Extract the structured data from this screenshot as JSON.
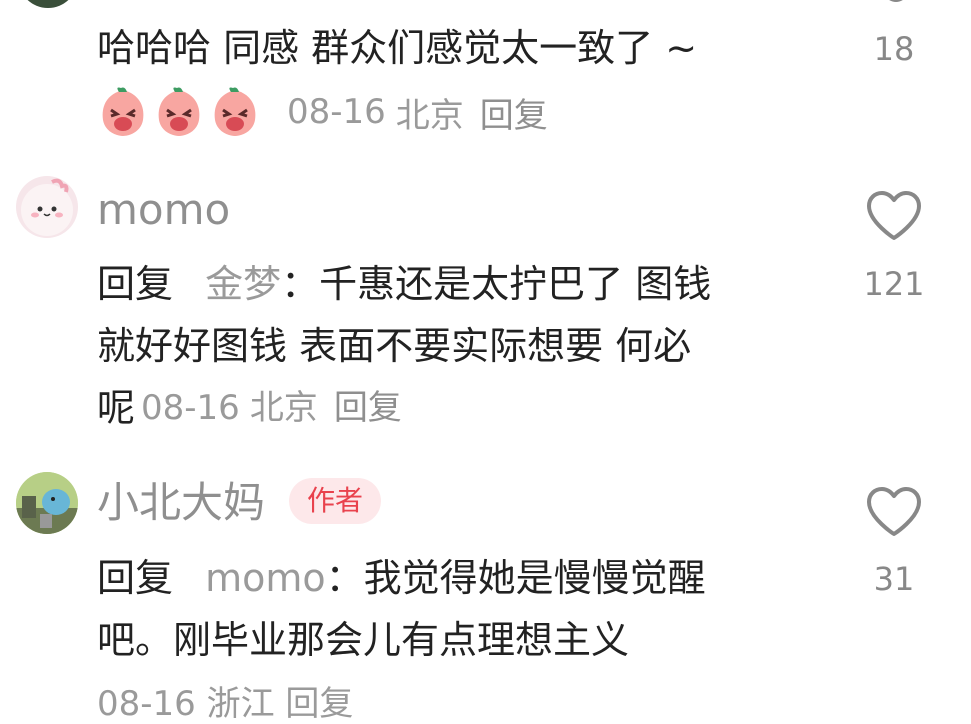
{
  "comment1": {
    "text": "哈哈哈 同感 群众们感觉太一致了 ~",
    "date": "08-16",
    "location": "北京",
    "reply": "回复",
    "likes": "18"
  },
  "comment2": {
    "username": "momo",
    "reply_prefix": "回复",
    "mention": "金梦",
    "line1": "：千惠还是太拧巴了 图钱",
    "line2": "就好好图钱 表面不要实际想要 何必",
    "line3": "呢",
    "date": "08-16",
    "location": "北京",
    "reply": "回复",
    "likes": "121"
  },
  "comment3": {
    "username": "小北大妈",
    "badge": "作者",
    "reply_prefix": "回复",
    "mention": "momo",
    "line1": "：我觉得她是慢慢觉醒",
    "line2": "吧。刚毕业那会儿有点理想主义",
    "meta_partial": "08-16 浙江  回复"
  }
}
